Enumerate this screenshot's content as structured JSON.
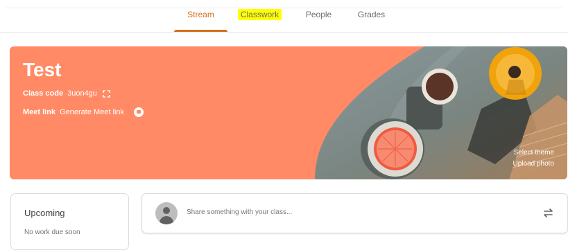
{
  "tabs": {
    "stream": "Stream",
    "classwork": "Classwork",
    "people": "People",
    "grades": "Grades"
  },
  "banner": {
    "title": "Test",
    "class_code_label": "Class code",
    "class_code_value": "3uon4gu",
    "meet_label": "Meet link",
    "meet_value": "Generate Meet link",
    "select_theme": "Select theme",
    "upload_photo": "Upload photo",
    "color": "#ff8a65"
  },
  "upcoming": {
    "title": "Upcoming",
    "status": "No work due soon"
  },
  "share": {
    "placeholder": "Share something with your class..."
  },
  "colors": {
    "accent": "#d56e1a",
    "highlight": "#ffff00"
  },
  "icons": {
    "expand": "expand-icon",
    "meet": "meet-video-icon",
    "avatar": "avatar-placeholder-icon",
    "repost": "repost-icon"
  }
}
